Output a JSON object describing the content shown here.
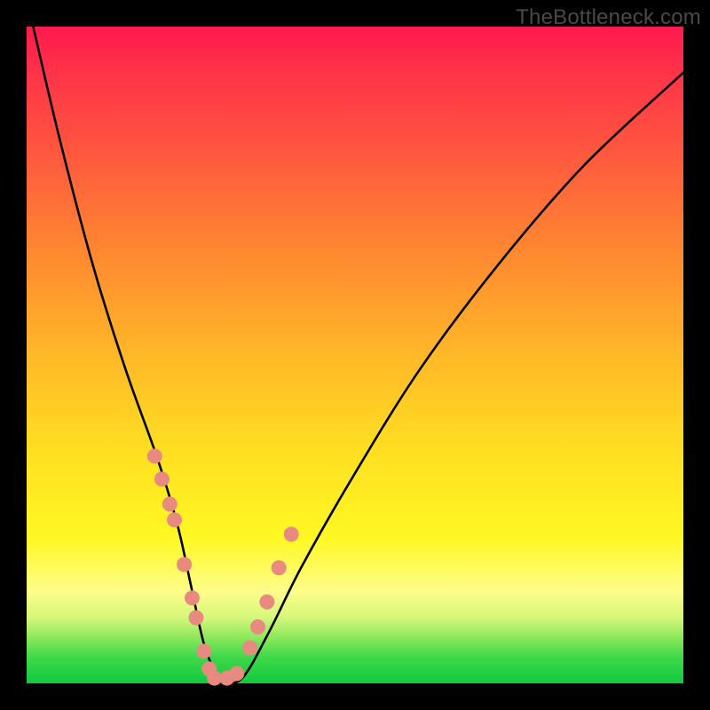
{
  "watermark": "TheBottleneck.com",
  "chart_data": {
    "type": "line",
    "title": "",
    "xlabel": "",
    "ylabel": "",
    "xlim": [
      0,
      100
    ],
    "ylim": [
      0,
      100
    ],
    "background": {
      "gradient": "vertical",
      "meaning": "top=high bottleneck (red), bottom=no bottleneck (green)",
      "stops": [
        {
          "pos": 0,
          "color": "#ff1a4d"
        },
        {
          "pos": 20,
          "color": "#ff5a3e"
        },
        {
          "pos": 50,
          "color": "#ffb828"
        },
        {
          "pos": 78,
          "color": "#fff824"
        },
        {
          "pos": 93,
          "color": "#8de85e"
        },
        {
          "pos": 100,
          "color": "#12c93e"
        }
      ]
    },
    "series": [
      {
        "name": "bottleneck-curve",
        "note": "V-shaped curve; percentages estimated from pixel position — no axis ticks present",
        "x": [
          1,
          5,
          10,
          15,
          20,
          23,
          25,
          27,
          29,
          30,
          33,
          37,
          42,
          50,
          60,
          72,
          85,
          100
        ],
        "y": [
          100,
          83,
          64,
          48,
          34,
          24,
          15,
          6,
          1,
          0,
          1,
          8,
          18,
          32,
          48,
          64,
          79,
          93
        ]
      }
    ],
    "markers": {
      "name": "highlighted-points",
      "color": "#e88a80",
      "x": [
        19.5,
        20.6,
        21.8,
        22.5,
        24.0,
        25.2,
        25.8,
        27.0,
        27.8,
        28.6,
        30.5,
        32.0,
        34.0,
        35.2,
        36.6,
        38.4,
        40.3
      ],
      "y": [
        34.6,
        31.1,
        27.3,
        24.9,
        18.1,
        13.0,
        10.0,
        4.9,
        2.2,
        0.8,
        0.8,
        1.5,
        5.4,
        8.6,
        12.4,
        17.6,
        22.7
      ]
    }
  }
}
